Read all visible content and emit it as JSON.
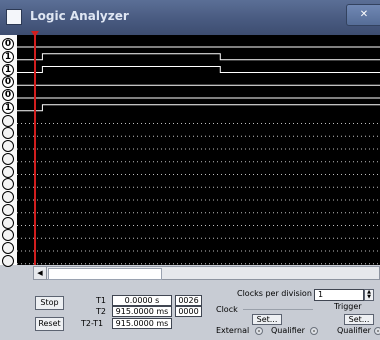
{
  "window": {
    "title": "Logic Analyzer"
  },
  "pins": [
    "0",
    "1",
    "1",
    "0",
    "0",
    "1",
    "",
    "",
    "",
    "",
    "",
    "",
    "",
    "",
    "",
    "",
    "",
    ""
  ],
  "controls": {
    "stop_label": "Stop",
    "reset_label": "Reset",
    "t1_label": "T1",
    "t2_label": "T2",
    "t2t1_label": "T2-T1",
    "t1_value": "0.0000  s",
    "t2_value": "915.0000 ms",
    "t2t1_value": "915.0000 ms",
    "t1_hex": "0026",
    "t2_hex": "0000",
    "clock_label": "Clock",
    "clocks_per_div_label": "Clocks per division",
    "clocks_per_div_value": "1",
    "clock_set_label": "Set...",
    "external_label": "External",
    "qualifier_label": "Qualifier",
    "trigger_label": "Trigger",
    "trigger_set_label": "Set...",
    "trigger_qualifier_label": "Qualifier"
  },
  "icons": {
    "app": "app-window-icon",
    "close": "close-icon",
    "scroll_left": "scroll-left-arrow-icon",
    "spin_up": "spin-up-icon",
    "spin_down": "spin-down-icon"
  },
  "signals": [
    {
      "high_ranges": []
    },
    {
      "high_ranges": [
        [
          0.07,
          0.56
        ]
      ]
    },
    {
      "high_ranges": [
        [
          0.07,
          0.56
        ]
      ]
    },
    {
      "high_ranges": []
    },
    {
      "high_ranges": []
    },
    {
      "high_ranges": [
        [
          0.07,
          1.0
        ]
      ]
    }
  ],
  "colors": {
    "trace": "#ffffff",
    "grid_dots": "#bfbfbf",
    "cursor": "#d11e1e",
    "background": "#000000"
  }
}
